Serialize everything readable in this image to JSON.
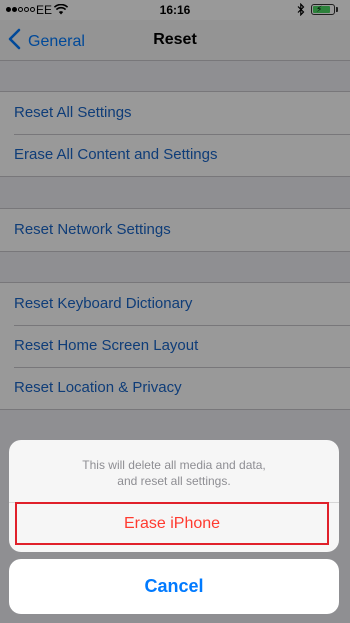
{
  "status_bar": {
    "carrier": "EE",
    "time": "16:16",
    "battery_fill": 0.85,
    "signal_bars_filled": 2,
    "signal_bars_total": 5
  },
  "nav": {
    "back_label": "General",
    "title": "Reset"
  },
  "groups": [
    {
      "items": [
        "Reset All Settings",
        "Erase All Content and Settings"
      ]
    },
    {
      "items": [
        "Reset Network Settings"
      ]
    },
    {
      "items": [
        "Reset Keyboard Dictionary",
        "Reset Home Screen Layout",
        "Reset Location & Privacy"
      ]
    }
  ],
  "action_sheet": {
    "message_line1": "This will delete all media and data,",
    "message_line2": "and reset all settings.",
    "destructive_label": "Erase iPhone",
    "cancel_label": "Cancel"
  },
  "colors": {
    "link_blue": "#1a66c9",
    "ios_blue": "#007aff",
    "destructive_red": "#ff3b30",
    "highlight_border": "#e0202a",
    "battery_green": "#4cd964"
  },
  "icons": {
    "back": "chevron-left-icon",
    "wifi": "wifi-icon",
    "bluetooth": "bluetooth-icon",
    "battery": "battery-charging-icon"
  }
}
